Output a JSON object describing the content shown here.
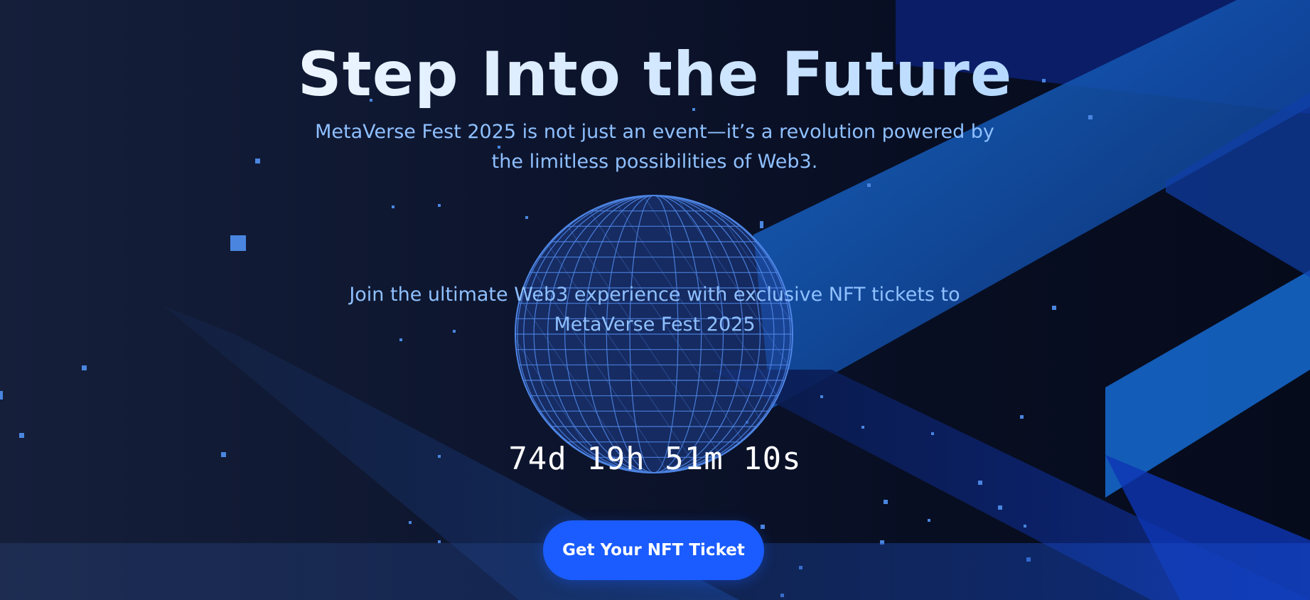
{
  "hero": {
    "title": "Step Into the Future",
    "subtitle": "MetaVerse Fest 2025 is not just an event—it’s a revolution powered by the limitless possibilities of Web3.",
    "tagline": "Join the ultimate Web3 experience with exclusive NFT tickets to MetaVerse Fest 2025",
    "countdown": "74d 19h 51m 10s",
    "cta_label": "Get Your NFT Ticket"
  },
  "colors": {
    "background": "#0a1024",
    "accent": "#1a5cff",
    "text_light_blue": "#8fc0ff",
    "globe_lines": "#4f86e6"
  },
  "icons": {
    "globe": "wireframe-globe-icon"
  }
}
